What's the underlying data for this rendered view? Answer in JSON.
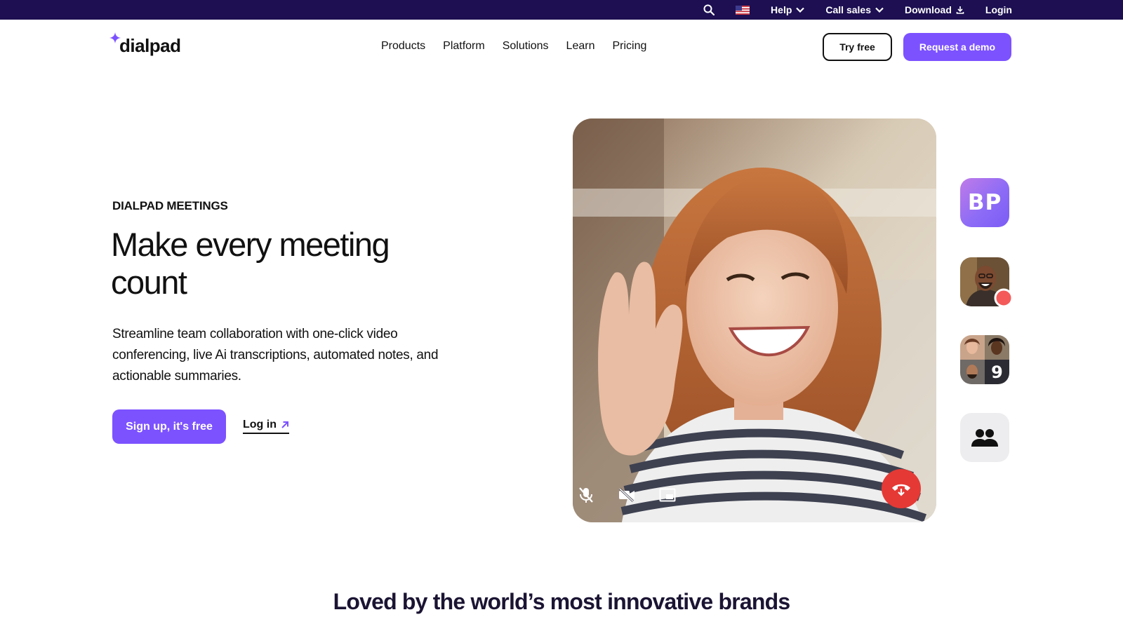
{
  "utility_bar": {
    "help_label": "Help",
    "call_sales_label": "Call sales",
    "download_label": "Download",
    "login_label": "Login",
    "search_icon": "search-icon",
    "flag_icon": "us-flag-icon"
  },
  "nav": {
    "logo_text": "dialpad",
    "links": [
      "Products",
      "Platform",
      "Solutions",
      "Learn",
      "Pricing"
    ],
    "try_free_label": "Try free",
    "request_demo_label": "Request a demo"
  },
  "hero": {
    "eyebrow": "DIALPAD MEETINGS",
    "headline": "Make every meeting count",
    "subtext": "Streamline team collaboration with one-click video conferencing, live Ai transcriptions, automated notes, and actionable summaries.",
    "signup_label": "Sign up, it's free",
    "login_label": "Log in"
  },
  "participants": {
    "initials": "BP",
    "extra_count": "9"
  },
  "brands": {
    "title": "Loved by the world’s most innovative brands"
  },
  "colors": {
    "utility_bg": "#1d0f52",
    "accent": "#7c52ff",
    "hangup": "#e53935"
  }
}
